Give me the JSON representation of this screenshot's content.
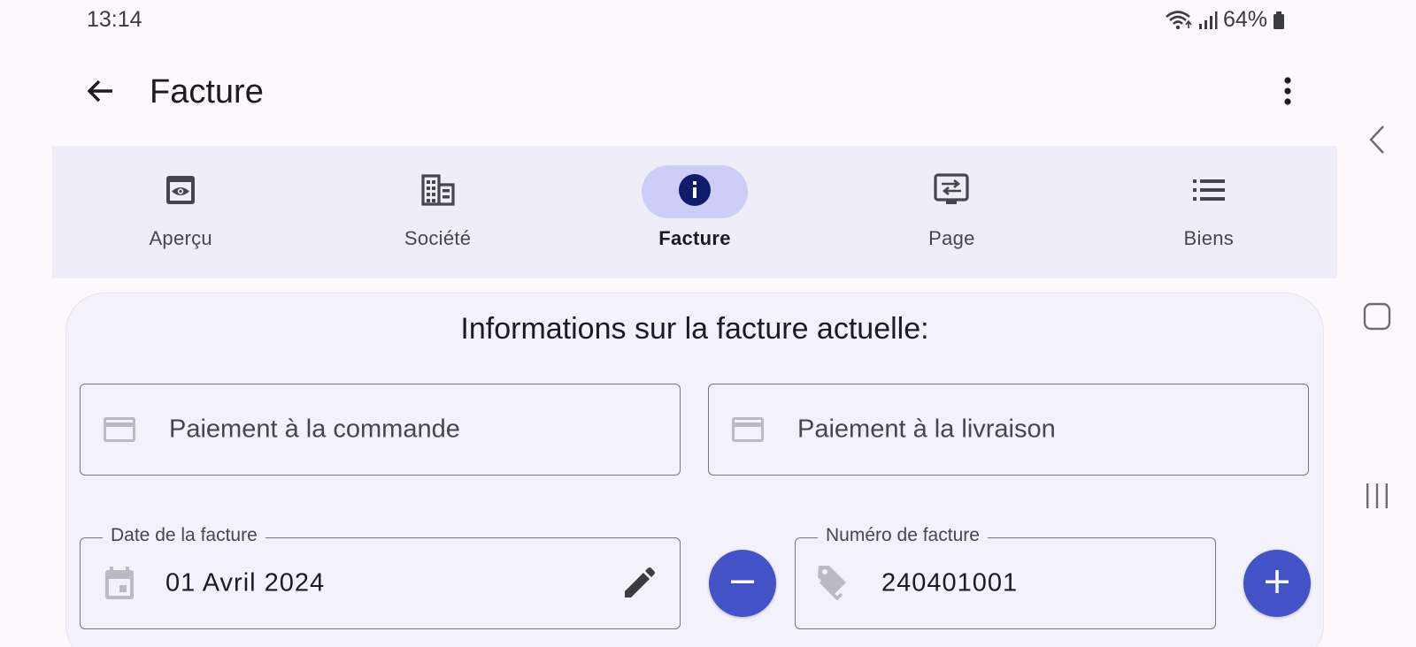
{
  "status_bar": {
    "time": "13:14",
    "battery": "64%"
  },
  "app_bar": {
    "title": "Facture"
  },
  "tabs": [
    {
      "label": "Aperçu",
      "icon": "eye-icon"
    },
    {
      "label": "Société",
      "icon": "building-icon"
    },
    {
      "label": "Facture",
      "icon": "info-icon",
      "active": true
    },
    {
      "label": "Page",
      "icon": "page-settings-icon"
    },
    {
      "label": "Biens",
      "icon": "list-icon"
    }
  ],
  "card": {
    "title": "Informations sur la facture actuelle:",
    "payment_order": "Paiement à la commande",
    "payment_delivery": "Paiement à la livraison",
    "date_label": "Date de la facture",
    "date_value": "01 Avril 2024",
    "number_label": "Numéro de facture",
    "number_value": "240401001"
  },
  "colors": {
    "background": "#fdf8fd",
    "tab_bar": "#eeedf8",
    "active_pill": "#cdcdf7",
    "active_icon": "#0f1c6b",
    "card": "#f3f2fc",
    "fab": "#4452c8"
  }
}
